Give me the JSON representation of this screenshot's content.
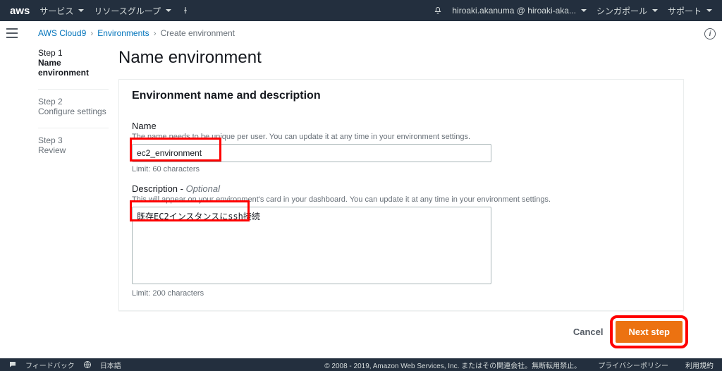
{
  "topnav": {
    "logo": "aws",
    "services": "サービス",
    "resource_groups": "リソースグループ",
    "account": "hiroaki.akanuma @ hiroaki-aka...",
    "region": "シンガポール",
    "support": "サポート"
  },
  "breadcrumbs": {
    "root": "AWS Cloud9",
    "environments": "Environments",
    "current": "Create environment"
  },
  "steps": {
    "s1_label": "Step 1",
    "s1_name": "Name environment",
    "s2_label": "Step 2",
    "s2_name": "Configure settings",
    "s3_label": "Step 3",
    "s3_name": "Review"
  },
  "page": {
    "title": "Name environment",
    "panel_header": "Environment name and description",
    "name_label": "Name",
    "name_hint": "The name needs to be unique per user. You can update it at any time in your environment settings.",
    "name_value": "ec2_environment",
    "name_limit": "Limit: 60 characters",
    "desc_label": "Description",
    "optional": "Optional",
    "desc_hint": "This will appear on your environment's card in your dashboard. You can update it at any time in your environment settings.",
    "desc_value": "既存EC2インスタンスにssh接続",
    "desc_limit": "Limit: 200 characters",
    "cancel": "Cancel",
    "next": "Next step"
  },
  "footer": {
    "feedback": "フィードバック",
    "language": "日本語",
    "copyright": "© 2008 - 2019, Amazon Web Services, Inc. またはその関連会社。無断転用禁止。",
    "privacy": "プライバシーポリシー",
    "terms": "利用規約"
  }
}
